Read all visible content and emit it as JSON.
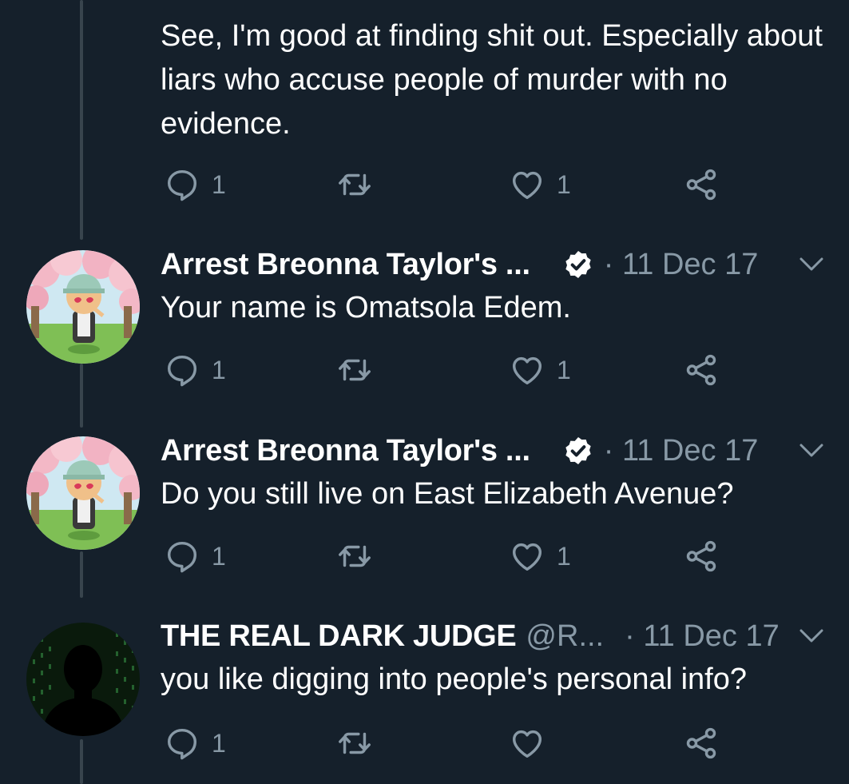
{
  "tweets": [
    {
      "body": "See, I'm good at finding shit out. Especially about liars who accuse people of murder with no evidence.",
      "replies": "1",
      "retweets": "",
      "likes": "1"
    },
    {
      "name": "Arrest Breonna Taylor's ...",
      "separator": "·",
      "date": "11 Dec 17",
      "body": "Your name is Omatsola Edem.",
      "replies": "1",
      "retweets": "",
      "likes": "1",
      "verified": true
    },
    {
      "name": "Arrest Breonna Taylor's ...",
      "separator": "·",
      "date": "11 Dec 17",
      "body": "Do you still live on East Elizabeth Avenue?",
      "replies": "1",
      "retweets": "",
      "likes": "1",
      "verified": true
    },
    {
      "name": "THE REAL DARK JUDGE",
      "handle": "@R...",
      "separator": "·",
      "date": "11 Dec 17",
      "body": "you like digging into people's personal info?",
      "replies": "1",
      "retweets": "",
      "likes": ""
    }
  ],
  "theme": {
    "background": "#15202b",
    "muted": "#8899a6",
    "thread_line": "#38444d"
  },
  "icons": [
    "reply-icon",
    "retweet-icon",
    "like-icon",
    "share-icon",
    "verified-badge-icon",
    "chevron-down-icon"
  ]
}
